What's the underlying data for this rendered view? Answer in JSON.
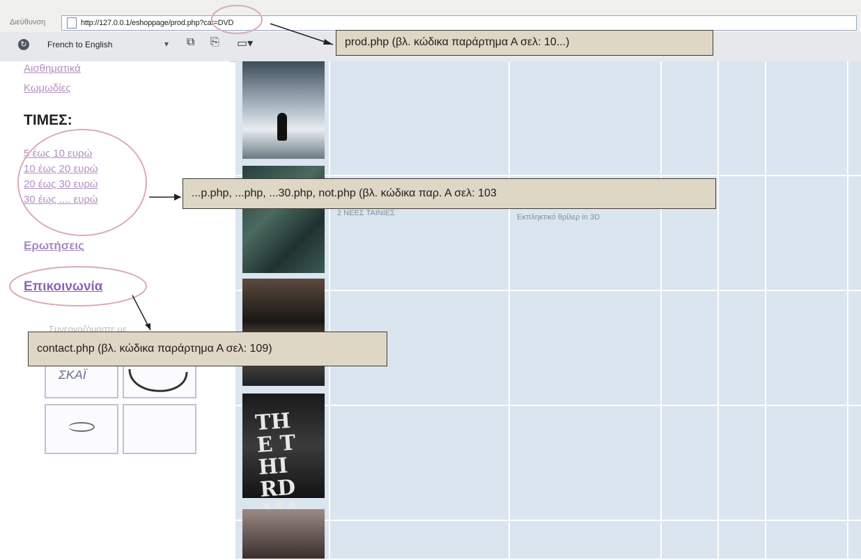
{
  "browser": {
    "address_label": "Διεύθυνση",
    "url": "http://127.0.0.1/eshoppage/prod.php?cat=DVD"
  },
  "toolbar": {
    "translate_label": "French to English",
    "dropdown_glyph": "▾"
  },
  "sidebar": {
    "top_links": [
      "Αισθηματικά",
      "Κωμωδίες"
    ],
    "prices_heading": "ΤΙΜΕΣ:",
    "price_links": [
      "5 έως 10 ευρώ",
      "10 έως 20 ευρώ",
      "20 έως 30 ευρώ",
      "30 έως .... ευρώ"
    ],
    "search_link": "Ερωτήσεις",
    "contact_link": "Επικοινωνία",
    "partners_heading": "Συνεργαζόμαστε με",
    "thumb_text": "ΣΚΑΪ"
  },
  "products": {
    "row2_title": "2 ΝΕΕΣ ΤΑΙΝΙΕΣ",
    "row2_desc": "Εκπληκτικό θρίλερ in 3D",
    "row4_cover_text": "THE THIRD MAN"
  },
  "annotations": {
    "prod": "prod.php (βλ. κώδικα παράρτημα Α σελ: 10...)",
    "price_pages": "...p.php, ...php, ...30.php, not.php (βλ. κώδικα παρ. Α σελ: 103",
    "contact": "contact.php (βλ. κώδικα παράρτημα Α σελ: 109)"
  },
  "colors": {
    "grid_bg": "#dbe5ef",
    "link_purple": "#b58cc4",
    "callout_bg": "#dfd7c5",
    "highlight_ring": "#d9aab8"
  },
  "icons": {
    "translate": "translate-icon",
    "toolbar1": "page-icon",
    "toolbar2": "copy-icon",
    "toolbar3": "screen-icon"
  }
}
